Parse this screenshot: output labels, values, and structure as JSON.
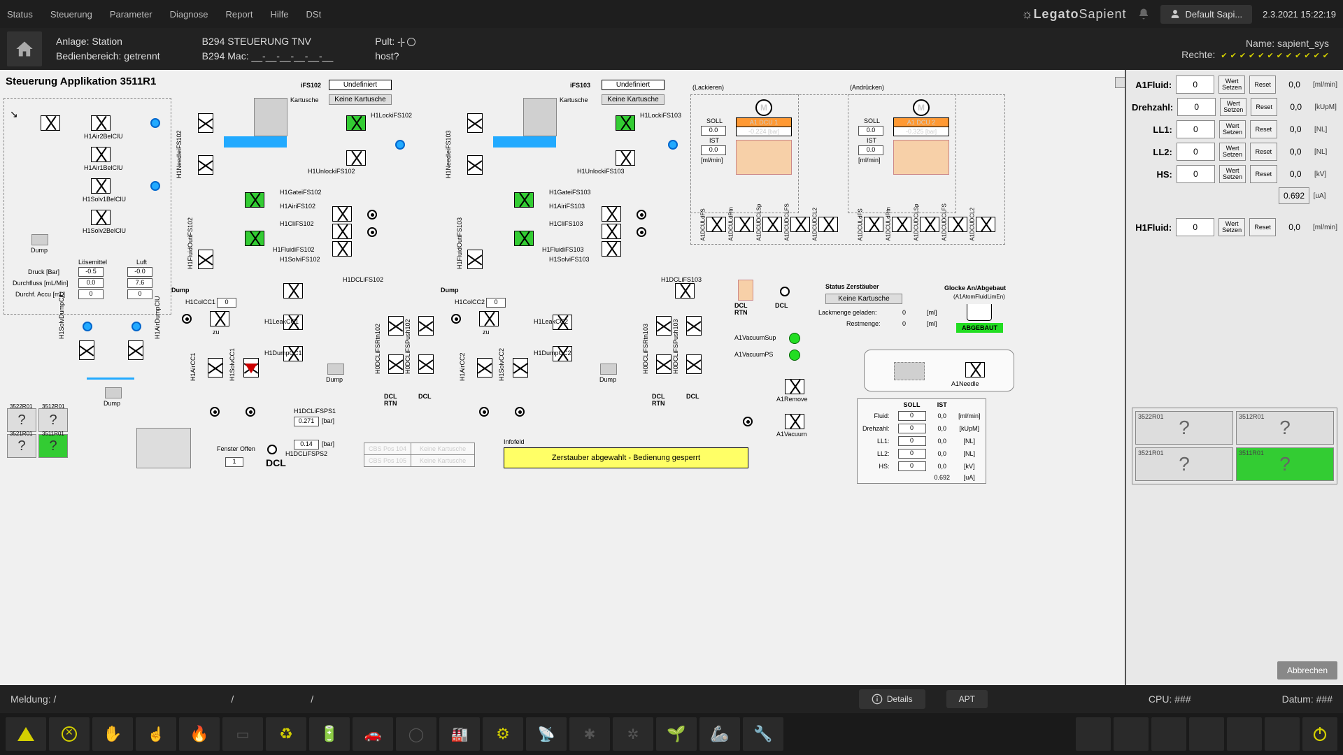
{
  "menu": [
    "Status",
    "Steuerung",
    "Parameter",
    "Diagnose",
    "Report",
    "Hilfe",
    "DSt"
  ],
  "brand_a": "Legato",
  "brand_b": "Sapient",
  "user_label": "Default Sapi...",
  "datetime": "2.3.2021  15:22:19",
  "info": {
    "anlage": "Anlage:  Station",
    "bedien": "Bedienbereich:  getrennt",
    "b294a": "B294 STEUERUNG TNV",
    "b294b": "B294 Mac: __-__-__-__-__-__",
    "pult": "Pult:",
    "host": "host?",
    "name": "Name:  sapient_sys",
    "rechte": "Rechte:"
  },
  "diagram": {
    "title": "Steuerung Applikation   3511R1",
    "ifs102": "iFS102",
    "ifs103": "iFS103",
    "undef": "Undefiniert",
    "kartusche": "Kartusche",
    "keine_kart": "Keine Kartusche",
    "lackieren": "(Lackieren)",
    "andruecken": "(Andrücken)",
    "h1lockfs102": "H1LockiFS102",
    "h1unlockfs102": "H1UnlockiFS102",
    "h1lockfs103": "H1LockiFS103",
    "h1unlockfs103": "H1UnlockiFS103",
    "h1gatefs102": "H1GateiFS102",
    "h1airfs102": "H1AiriFS102",
    "h1clfs102": "H1CliFS102",
    "h1fluidfs102": "H1FluidiFS102",
    "h1solvfs102": "H1SolviFS102",
    "h1gatefs103": "H1GateiFS103",
    "h1airfs103": "H1AiriFS103",
    "h1clfs103": "H1CliFS103",
    "h1fluidfs103": "H1FluidiFS103",
    "h1solvfs103": "H1SolviFS103",
    "h1needfs102": "H1NeedleiFS102",
    "h1needfs103": "H1NeedleiFS103",
    "h1air2bel": "H1Air2BelClU",
    "h1air1bel": "H1Air1BelClU",
    "h1solv1bel": "H1Solv1BelClU",
    "h1solv2bel": "H1Solv2BelClU",
    "h1solvdump": "H1SolvDumpClU",
    "h1airdump": "H1AirDumpClU",
    "h1fluidout102": "H1FluidOutiFS102",
    "h1fluidout103": "H1FluidOutiFS103",
    "dump": "Dump",
    "loesemittel": "Lösemittel",
    "luft": "Luft",
    "druck": "Druck [Bar]",
    "durchfluss": "Durchfluss [mL/Min]",
    "durchf_accu": "Durchf. Accu [mL]",
    "druck_l": "-0.5",
    "druck_r": "-0.0",
    "df_l": "0.0",
    "df_r": "7.6",
    "da_l": "0",
    "da_r": "0",
    "h1colcc1": "H1ColCC1",
    "h1colcc2": "H1ColCC2",
    "h1colcc1v": "0",
    "h1colcc2v": "0",
    "zu": "zu",
    "h1leakcc1": "H1LeakCC1",
    "h1leakcc2": "H1LeakCC2",
    "h1dumpcc1": "H1DumpCC1",
    "h1dumpcc2": "H1DumpCC2",
    "h1aircc1": "H1AirCC1",
    "h1solvcc1": "H1SolvCC1",
    "h1aircc2": "H1AirCC2",
    "h1solvcc2": "H1SolvCC2",
    "h1dclfs102": "H1DCLiFS102",
    "h1dclfs103": "H1DCLiFS103",
    "h0dclfsrtn102": "H0DCLiFSRtn102",
    "h0dclfspush102": "H0DCLiFSPush102",
    "h0dclfsrtn103": "H0DCLiFSRtn103",
    "h0dclfspush103": "H0DCLiFSPush103",
    "dcl": "DCL",
    "dcl_rtn": "DCL\nRTN",
    "h1dclsps1": "H1DCLiFSPS1",
    "h1dclsps2": "H1DCLiFSPS2",
    "h1dclsps1v": "0.271",
    "h1dclsps2v": "0.14",
    "bar": "[bar]",
    "fenster": "Fenster Offen",
    "fenster_v": "1",
    "cbs104": "CBS Pos 104",
    "cbs105": "CBS Pos 105",
    "infofeld": "Infofeld",
    "banner": "Zerstauber abgewahlt - Bedienung gesperrt",
    "a1dcu1": "A1 DCU 1",
    "a1dcu2": "A1 DCU 2",
    "dcu1_v": "-0.224",
    "dcu2_v": "-0.325",
    "soll": "SOLL",
    "ist": "IST",
    "zero": "0.0",
    "mlmin": "[ml/min]",
    "a1dculdfs": "A1DCULdFS",
    "a1dculdrtn": "A1DCULdRtn",
    "a1dcudclsp": "A1DCUDCLSp",
    "a1dcudclfs": "A1DCUDCLFS",
    "a1dcudcl2": "A1DCUDCL2",
    "a1dcudfs2": "A1DCULdFS",
    "a1dculdrtn2": "A1DCULdRtn",
    "a1dcudclsp2": "A1DCUDCLSp",
    "a1dcudclfs2": "A1DCUDCLFS",
    "a1dcudcl22": "A1DCUDCL2",
    "a1vacsup": "A1VacuumSup",
    "a1vacps": "A1VacuumPS",
    "a1remove": "A1Remove",
    "a1vacuum": "A1Vacuum",
    "a1needle": "A1Needle",
    "status_zer": "Status Zerstäuber",
    "lack_gel": "Lackmenge geladen:",
    "restmenge": "Restmenge:",
    "lack_v": "0",
    "rest_v": "0",
    "ml": "[ml]",
    "glocke": "Glocke An/Abgebaut",
    "glocke_sub": "(A1AtomFluidLimEn)",
    "abgebaut": "ABGEBAUT",
    "soll_tbl": {
      "fluid": "Fluid:",
      "drehzahl": "Drehzahl:",
      "ll1": "LL1:",
      "ll2": "LL2:",
      "hs": "HS:",
      "vals": [
        "0",
        "0",
        "0",
        "0",
        "0"
      ],
      "ist_vals": [
        "0,0",
        "0,0",
        "0,0",
        "0,0",
        "0,0",
        "0.692"
      ],
      "units": [
        "[ml/min]",
        "[kUpM]",
        "[NL]",
        "[NL]",
        "[kV]",
        "[uA]"
      ]
    },
    "stations_lbl": [
      "3522R01",
      "3512R01",
      "3521R01",
      "3511R01"
    ]
  },
  "side": {
    "rows": [
      {
        "label": "A1Fluid:",
        "v": "0",
        "ist": "0,0",
        "unit": "[ml/min]"
      },
      {
        "label": "Drehzahl:",
        "v": "0",
        "ist": "0,0",
        "unit": "[kUpM]"
      },
      {
        "label": "LL1:",
        "v": "0",
        "ist": "0,0",
        "unit": "[NL]"
      },
      {
        "label": "LL2:",
        "v": "0",
        "ist": "0,0",
        "unit": "[NL]"
      },
      {
        "label": "HS:",
        "v": "0",
        "ist": "0,0",
        "unit": "[kV]"
      }
    ],
    "extra_ist": "0.692",
    "extra_unit": "[uA]",
    "h1fluid": {
      "label": "H1Fluid:",
      "v": "0",
      "ist": "0,0",
      "unit": "[ml/min]"
    },
    "btn_wert": "Wert\nSetzen",
    "btn_reset": "Reset",
    "stations": [
      "3522R01",
      "3512R01",
      "3521R01",
      "3511R01"
    ],
    "cancel": "Abbrechen"
  },
  "msgbar": {
    "meldung": "Meldung:   /",
    "s2": "/",
    "s3": "/",
    "details": "Details",
    "apt": "APT",
    "cpu": "CPU: ###",
    "datum": "Datum: ###"
  }
}
